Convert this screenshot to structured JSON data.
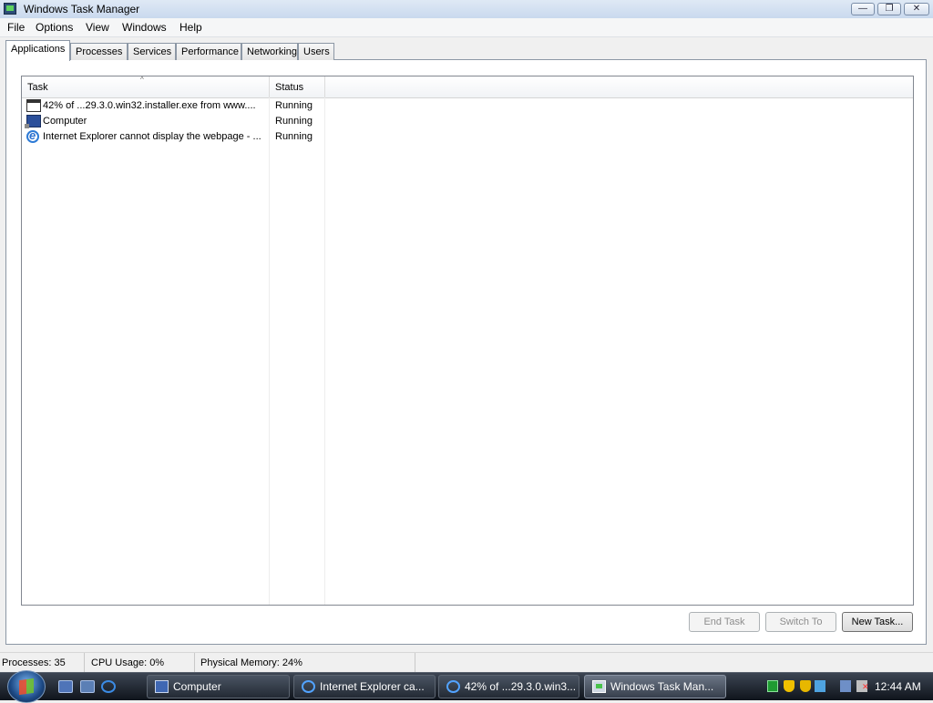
{
  "window": {
    "title": "Windows Task Manager",
    "controls": {
      "minimize": "—",
      "maximize": "❐",
      "close": "✕"
    }
  },
  "menu": [
    "File",
    "Options",
    "View",
    "Windows",
    "Help"
  ],
  "tabs": [
    {
      "label": "Applications",
      "active": true
    },
    {
      "label": "Processes",
      "active": false
    },
    {
      "label": "Services",
      "active": false
    },
    {
      "label": "Performance",
      "active": false
    },
    {
      "label": "Networking",
      "active": false
    },
    {
      "label": "Users",
      "active": false
    }
  ],
  "list": {
    "columns": {
      "task": "Task",
      "status": "Status"
    },
    "sort_indicator": "^",
    "rows": [
      {
        "icon": "window-icon",
        "task": "42% of ...29.3.0.win32.installer.exe from www....",
        "status": "Running"
      },
      {
        "icon": "computer-icon",
        "task": "Computer",
        "status": "Running"
      },
      {
        "icon": "internet-explorer-icon",
        "task": "Internet Explorer cannot display the webpage - ...",
        "status": "Running"
      }
    ]
  },
  "buttons": {
    "end_task": "End Task",
    "switch_to": "Switch To",
    "new_task": "New Task..."
  },
  "statusbar": {
    "processes": "Processes: 35",
    "cpu": "CPU Usage: 0%",
    "memory": "Physical Memory: 24%"
  },
  "taskbar": {
    "items": [
      {
        "label": "Computer",
        "icon": "computer-icon",
        "active": false
      },
      {
        "label": "Internet Explorer ca...",
        "icon": "internet-explorer-icon",
        "active": false
      },
      {
        "label": "42% of ...29.3.0.win3...",
        "icon": "internet-explorer-icon",
        "active": false
      },
      {
        "label": "Windows Task Man...",
        "icon": "task-manager-icon",
        "active": true
      }
    ],
    "clock": "12:44 AM"
  }
}
